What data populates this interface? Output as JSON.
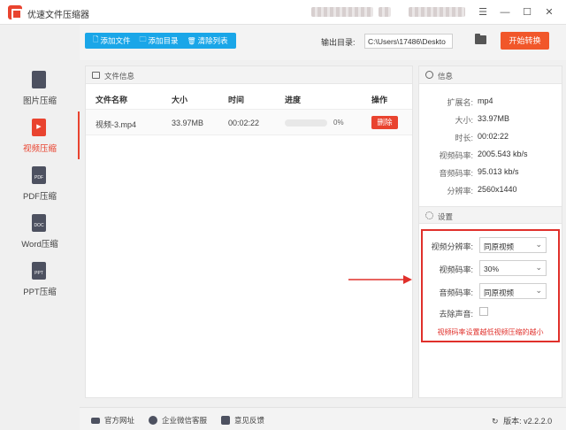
{
  "app": {
    "title": "优速文件压缩器",
    "window": {
      "menu": "☰",
      "minimize": "—",
      "maximize": "☐",
      "close": "✕"
    }
  },
  "toolbar": {
    "add_file": "添加文件",
    "add_dir": "添加目录",
    "clear_list": "清除列表",
    "output_label": "输出目录:",
    "output_path": "C:\\Users\\17486\\Deskto",
    "start": "开始转换"
  },
  "sidebar": {
    "items": [
      {
        "label": "图片压缩",
        "icon": "image-file-icon",
        "badge": "",
        "active": false
      },
      {
        "label": "视频压缩",
        "icon": "video-file-icon",
        "badge": "▶",
        "active": true
      },
      {
        "label": "PDF压缩",
        "icon": "pdf-file-icon",
        "badge": "PDF",
        "active": false
      },
      {
        "label": "Word压缩",
        "icon": "word-file-icon",
        "badge": "DOC",
        "active": false
      },
      {
        "label": "PPT压缩",
        "icon": "ppt-file-icon",
        "badge": "PPT",
        "active": false
      }
    ]
  },
  "files": {
    "title": "文件信息",
    "columns": {
      "name": "文件名称",
      "size": "大小",
      "time": "时间",
      "progress": "进度",
      "action": "操作"
    },
    "rows": [
      {
        "name": "视频-3.mp4",
        "size": "33.97MB",
        "time": "00:02:22",
        "progress": 0,
        "progress_text": "0%",
        "action": "删除"
      }
    ]
  },
  "info": {
    "title": "信息",
    "rows": [
      {
        "key": "扩展名:",
        "value": "mp4"
      },
      {
        "key": "大小:",
        "value": "33.97MB"
      },
      {
        "key": "时长:",
        "value": "00:02:22"
      },
      {
        "key": "视频码率:",
        "value": "2005.543 kb/s"
      },
      {
        "key": "音频码率:",
        "value": "95.013 kb/s"
      },
      {
        "key": "分辨率:",
        "value": "2560x1440"
      }
    ]
  },
  "settings": {
    "title": "设置",
    "resolution_label": "视频分辨率:",
    "resolution_value": "同原视频",
    "bitrate_label": "视频码率:",
    "bitrate_value": "30%",
    "audio_label": "音频码率:",
    "audio_value": "同原视频",
    "mute_label": "去除声音:",
    "mute_checked": false,
    "hint": "视频码率设置越低视频压缩的越小"
  },
  "statusbar": {
    "website": "官方网址",
    "support": "企业微信客服",
    "feedback": "意见反馈",
    "version": "版本: v2.2.2.0"
  },
  "colors": {
    "accent": "#1aa6e8",
    "brand": "#e9432f",
    "highlight": "#e0302b"
  }
}
